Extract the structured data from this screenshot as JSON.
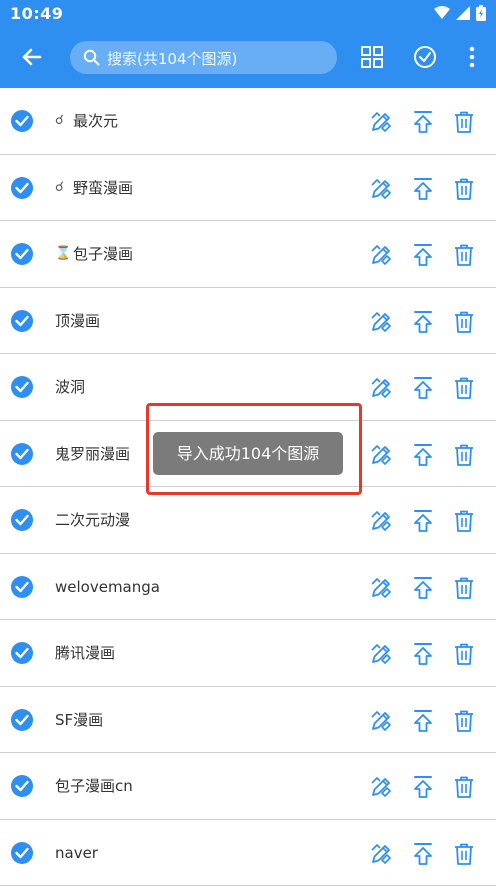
{
  "status_bar": {
    "time": "10:49"
  },
  "toolbar": {
    "search_placeholder": "搜索(共104个图源)"
  },
  "sources": [
    {
      "name": "最次元",
      "glyph": "☌"
    },
    {
      "name": "野蛮漫画",
      "glyph": "☌"
    },
    {
      "name": "包子漫画",
      "glyph": "⌛"
    },
    {
      "name": "顶漫画",
      "glyph": ""
    },
    {
      "name": "波洞",
      "glyph": ""
    },
    {
      "name": "鬼罗丽漫画",
      "glyph": ""
    },
    {
      "name": "二次元动漫",
      "glyph": ""
    },
    {
      "name": "welovemanga",
      "glyph": ""
    },
    {
      "name": "腾讯漫画",
      "glyph": ""
    },
    {
      "name": "SF漫画",
      "glyph": ""
    },
    {
      "name": "包子漫画cn",
      "glyph": ""
    },
    {
      "name": "naver",
      "glyph": ""
    }
  ],
  "toast": {
    "message": "导入成功104个图源"
  },
  "colors": {
    "primary": "#2f8ff0",
    "highlight": "#e5392b",
    "toast_bg": "#7b7b7b"
  }
}
